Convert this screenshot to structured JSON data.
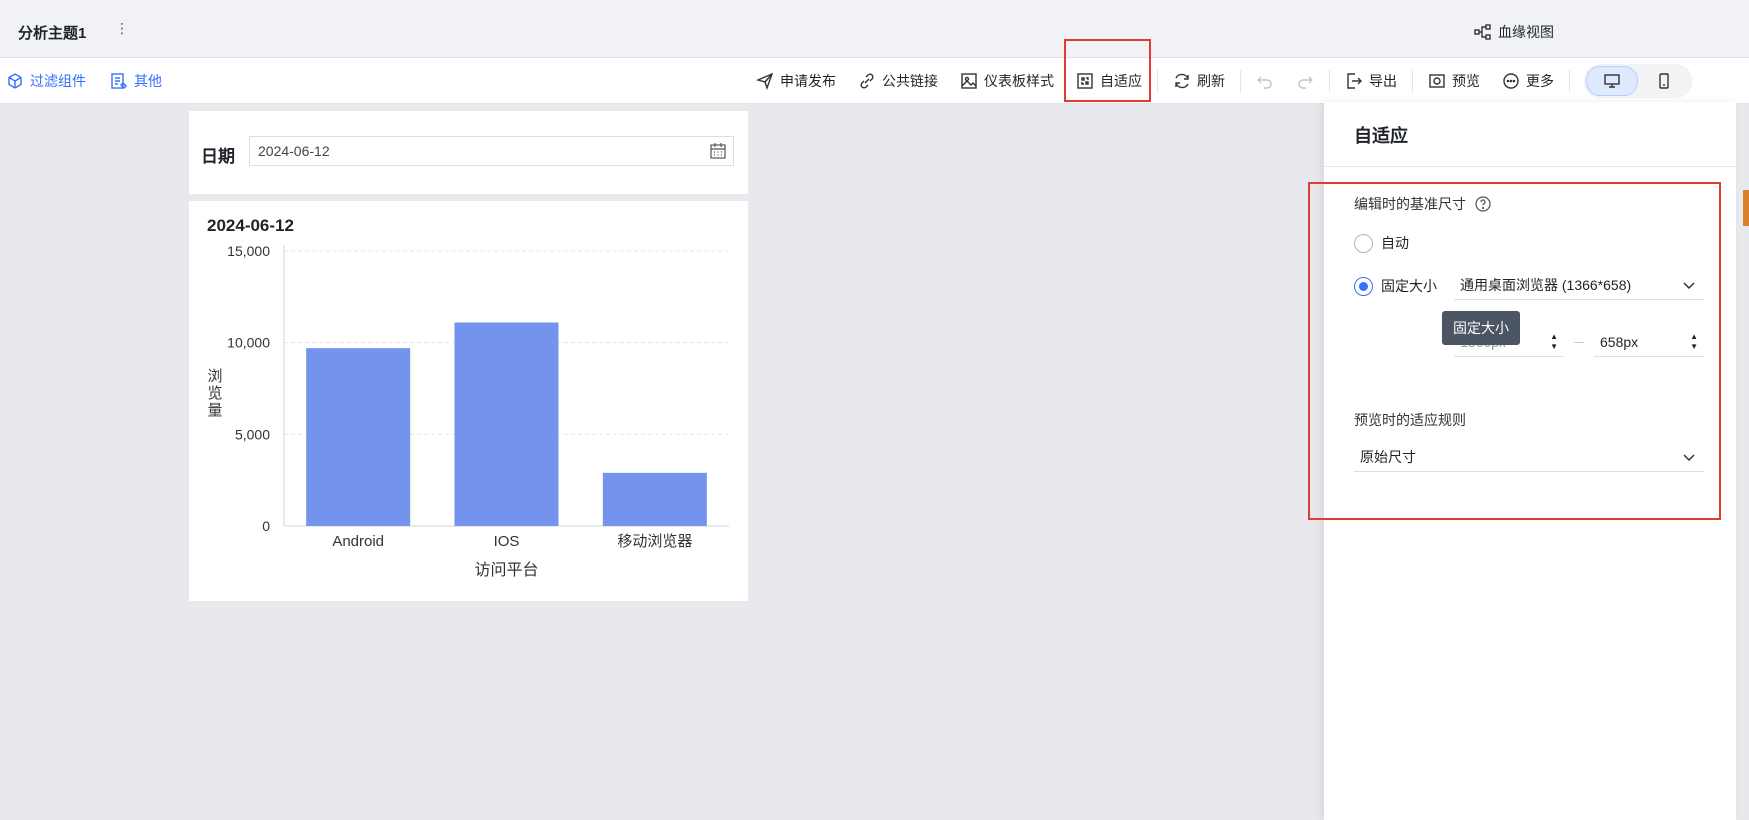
{
  "header": {
    "title": "分析主题1",
    "more_icon": "vertical-dots-icon",
    "lineage_label": "血缘视图"
  },
  "toolbar": {
    "left": [
      {
        "label": "过滤组件",
        "icon": "filter-cube-icon"
      },
      {
        "label": "其他",
        "icon": "edit-list-icon"
      }
    ],
    "publish": "申请发布",
    "public_link": "公共链接",
    "dashboard_style": "仪表板样式",
    "adaptive": "自适应",
    "refresh": "刷新",
    "export": "导出",
    "preview": "预览",
    "more": "更多",
    "accent_color": "#3370ff"
  },
  "filter": {
    "label": "日期",
    "value": "2024-06-12"
  },
  "chart_title": "2024-06-12",
  "chart_data": {
    "type": "bar",
    "title": "2024-06-12",
    "categories": [
      "Android",
      "IOS",
      "移动浏览器"
    ],
    "values": [
      9700,
      11100,
      2900
    ],
    "xlabel": "访问平台",
    "ylabel": "浏览量",
    "ylim": [
      0,
      15000
    ],
    "yticks": [
      "0",
      "5,000",
      "10,000",
      "15,000"
    ],
    "ytick_values": [
      0,
      5000,
      10000,
      15000
    ],
    "grid": true,
    "bar_color": "#7393ec"
  },
  "panel": {
    "title": "自适应",
    "edit_section_title": "编辑时的基准尺寸",
    "help_icon": "question-circle-icon",
    "option_auto": "自动",
    "option_fixed": "固定大小",
    "preset_value": "通用桌面浏览器 (1366*658)",
    "width_value": "1366px",
    "height_value": "658px",
    "tooltip": "固定大小",
    "preview_section_title": "预览时的适应规则",
    "preview_rule_value": "原始尺寸"
  },
  "colors": {
    "highlight_border": "#e53935",
    "radio_checked": "#3370ff"
  }
}
